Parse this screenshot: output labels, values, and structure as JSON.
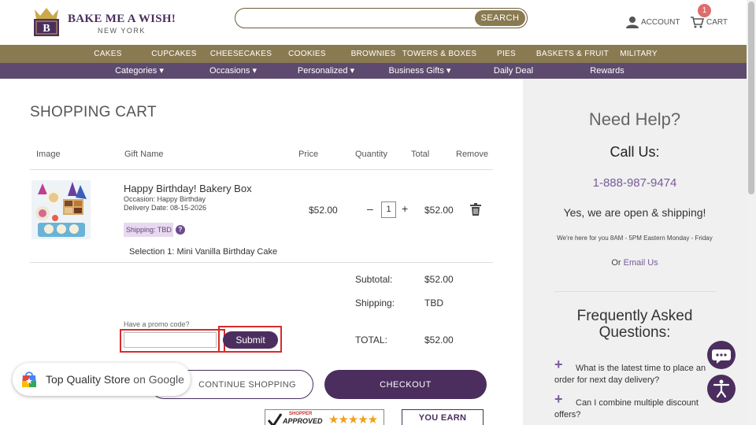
{
  "header": {
    "brand_name": "BAKE ME A WISH!",
    "brand_sub": "NEW YORK",
    "logo_letter": "B",
    "search_placeholder": "",
    "search_button": "SEARCH",
    "account_label": "ACCOUNT",
    "cart_label": "CART",
    "cart_count": "1"
  },
  "nav_primary": [
    "CAKES",
    "CUPCAKES",
    "CHEESECAKES",
    "COOKIES",
    "BROWNIES",
    "TOWERS & BOXES",
    "PIES",
    "BASKETS & FRUIT",
    "MILITARY"
  ],
  "nav_secondary": [
    "Categories ▾",
    "Occasions ▾",
    "Personalized ▾",
    "Business Gifts ▾",
    "Daily Deal",
    "Rewards"
  ],
  "cart": {
    "title": "SHOPPING CART",
    "columns": {
      "image": "Image",
      "gift_name": "Gift Name",
      "price": "Price",
      "quantity": "Quantity",
      "total": "Total",
      "remove": "Remove"
    },
    "item": {
      "name": "Happy Birthday! Bakery Box",
      "occasion": "Occasion: Happy Birthday",
      "delivery": "Delivery Date: 08-15-2026",
      "shipping_tag": "Shipping: TBD",
      "help_glyph": "?",
      "selection": "Selection 1: Mini Vanilla Birthday Cake",
      "price": "$52.00",
      "quantity": "1",
      "minus": "–",
      "plus": "+",
      "total": "$52.00"
    },
    "summary": {
      "subtotal_label": "Subtotal:",
      "subtotal_value": "$52.00",
      "shipping_label": "Shipping:",
      "shipping_value": "TBD",
      "total_label": "TOTAL:",
      "total_value": "$52.00"
    },
    "promo": {
      "label": "Have a promo code?",
      "input_value": "",
      "submit": "Submit"
    },
    "continue_button": "CONTINUE SHOPPING",
    "checkout_button": "CHECKOUT"
  },
  "badges": {
    "google_main": "Top Quality Store",
    "google_suffix": "on Google",
    "shopper_top": "SHOPPER",
    "shopper_approved": "APPROVED",
    "shopper_stars": "★★★★★",
    "you_earn": "YOU EARN"
  },
  "sidebar": {
    "need_help": "Need Help?",
    "call_us": "Call Us:",
    "phone": "1-888-987-9474",
    "open_msg": "Yes, we are open & shipping!",
    "hours": "We're here for you 8AM - 5PM Eastern Monday - Friday",
    "or_text": "Or",
    "email_link": "Email Us",
    "faq_title": "Frequently Asked Questions:",
    "faq": [
      "What is the latest time to place an order for next day delivery?",
      "Can I combine multiple discount offers?"
    ]
  },
  "colors": {
    "brand_purple": "#4b2e5e",
    "nav_gold": "#8a7a52",
    "nav_purple": "#5d4a6e",
    "highlight_red": "#d92b2b",
    "link_purple": "#7a5a9a"
  }
}
